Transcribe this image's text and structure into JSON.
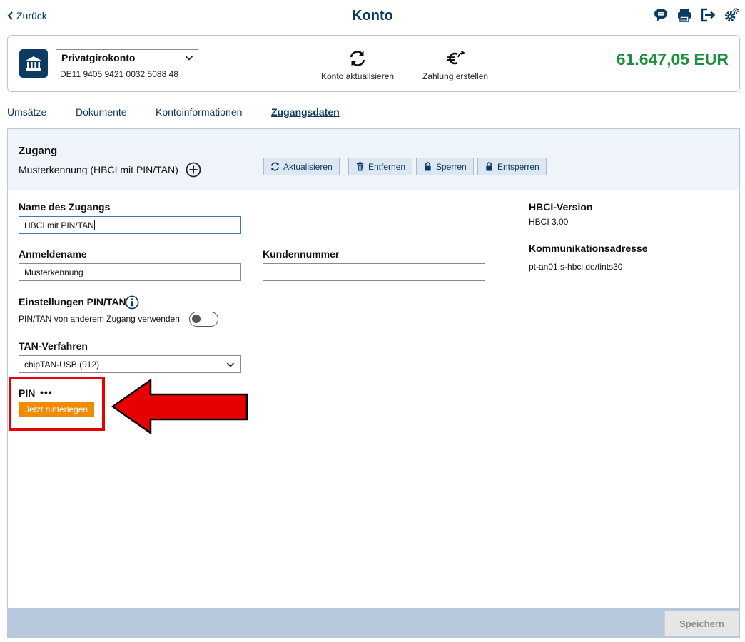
{
  "header": {
    "back_label": "Zurück",
    "title": "Konto",
    "icons": [
      "chat-icon",
      "printer-icon",
      "logout-icon",
      "settings-icon"
    ]
  },
  "account": {
    "name": "Privatgirokonto",
    "iban": "DE11 9405 9421 0032 5088 48",
    "refresh_label": "Konto aktualisieren",
    "payment_label": "Zahlung erstellen",
    "balance": "61.647,05 EUR"
  },
  "tabs": [
    {
      "label": "Umsätze",
      "active": false
    },
    {
      "label": "Dokumente",
      "active": false
    },
    {
      "label": "Kontoinformationen",
      "active": false
    },
    {
      "label": "Zugangsdaten",
      "active": true
    }
  ],
  "access": {
    "title": "Zugang",
    "subtitle": "Musterkennung (HBCI mit PIN/TAN)",
    "buttons": {
      "refresh": "Aktualisieren",
      "remove": "Entfernen",
      "lock": "Sperren",
      "unlock": "Entsperren"
    }
  },
  "form": {
    "name_label": "Name des Zugangs",
    "name_value": "HBCI mit PIN/TAN",
    "login_label": "Anmeldename",
    "login_value": "Musterkennung",
    "customer_label": "Kundennummer",
    "customer_value": "",
    "pintan_label": "Einstellungen PIN/TAN",
    "toggle_label": "PIN/TAN von anderem Zugang verwenden",
    "toggle_on": false,
    "tan_label": "TAN-Verfahren",
    "tan_value": "chipTAN-USB (912)",
    "pin_label": "PIN",
    "pin_dots": "•••",
    "pin_button": "Jetzt hinterlegen"
  },
  "info": {
    "hbci_label": "HBCI-Version",
    "hbci_value": "HBCI 3.00",
    "address_label": "Kommunikationsadresse",
    "address_value": "pt-an01.s-hbci.de/fints30"
  },
  "footer": {
    "save_label": "Speichern"
  },
  "colors": {
    "primary": "#0b3a63",
    "balance": "#1e8f3e",
    "accent_orange": "#f08a00",
    "highlight_red": "#e60000",
    "footer_bg": "#b7c7dc"
  }
}
